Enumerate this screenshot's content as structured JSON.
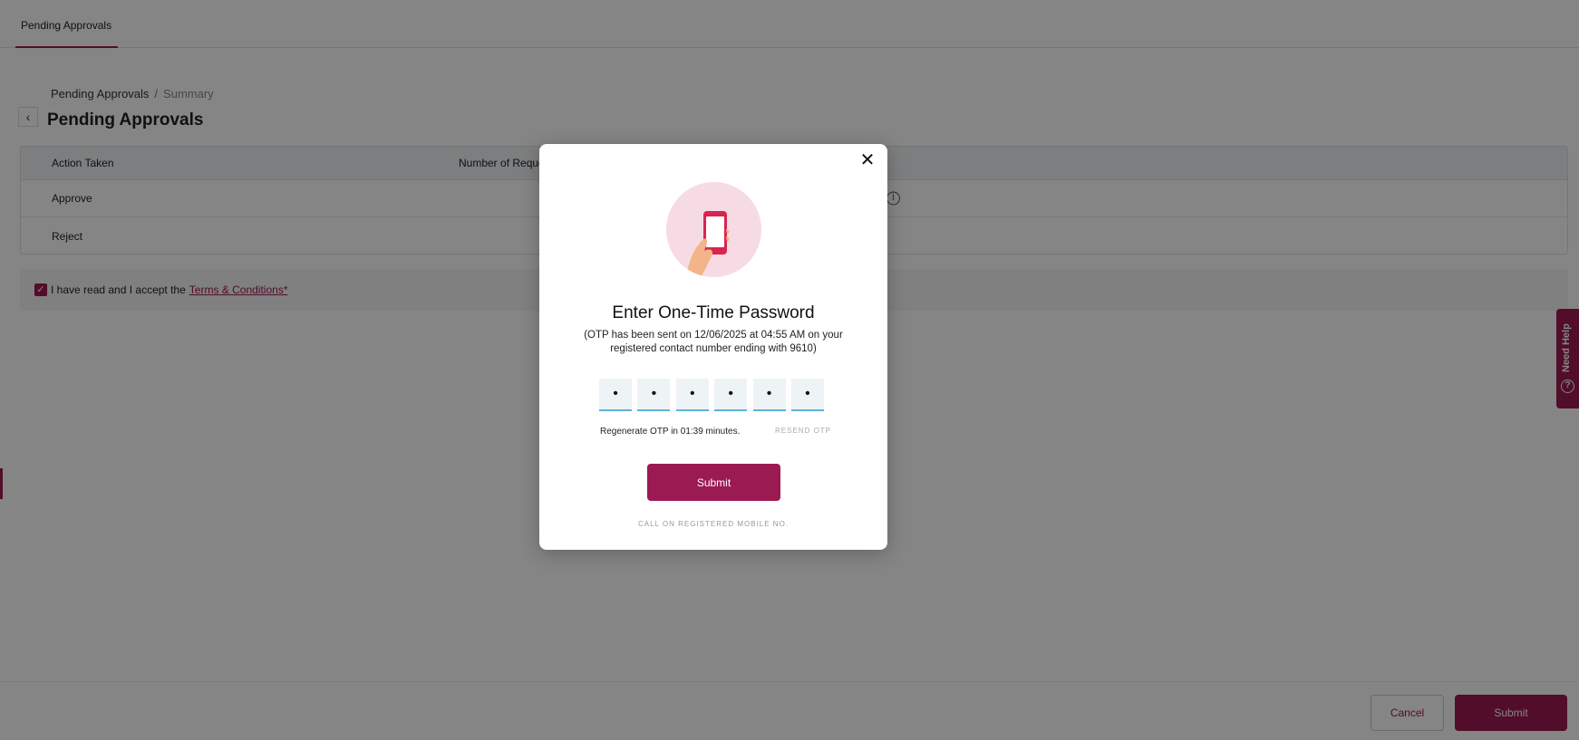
{
  "topbar": {
    "active_tab": "Pending Approvals"
  },
  "breadcrumb": {
    "parent": "Pending Approvals",
    "separator": "/",
    "current": "Summary"
  },
  "page": {
    "title": "Pending Approvals"
  },
  "table": {
    "columns": [
      "Action Taken",
      "Number of Reques"
    ],
    "rows": [
      {
        "action": "Approve"
      },
      {
        "action": "Reject"
      }
    ]
  },
  "terms": {
    "text": "I have read and I accept the",
    "link": "Terms & Conditions*",
    "checked": true
  },
  "need_help": {
    "label": "Need Help"
  },
  "footer": {
    "cancel_label": "Cancel",
    "submit_label": "Submit"
  },
  "modal": {
    "title": "Enter One-Time Password",
    "description": "(OTP has been sent on 12/06/2025 at 04:55 AM on your registered contact number ending with 9610)",
    "otp_digits": [
      "•",
      "•",
      "•",
      "•",
      "•",
      "•"
    ],
    "regenerate_text": "Regenerate OTP in 01:39 minutes.",
    "resend_label": "RESEND OTP",
    "submit_label": "Submit",
    "call_label": "CALL ON REGISTERED MOBILE NO."
  },
  "colors": {
    "brand": "#9c1a52",
    "otp_underline": "#5fb0d4",
    "illustration_bg": "#f7dbe4"
  }
}
